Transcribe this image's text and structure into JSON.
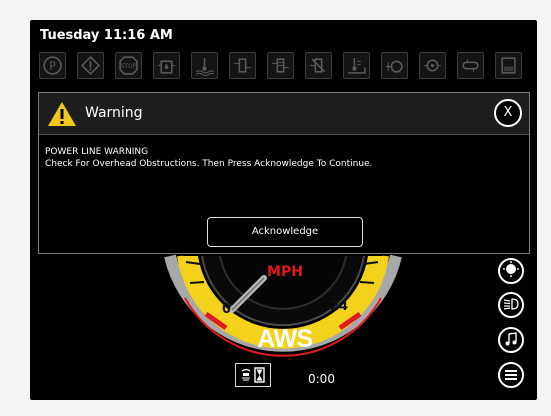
{
  "header": {
    "datetime": "Tuesday 11:16 AM"
  },
  "status_icons": [
    "parking-brake-icon",
    "warning-triangle-icon",
    "stop-icon",
    "fuel-water-icon",
    "coolant-temp-icon",
    "hydraulic-filter-icon",
    "hydraulic-filter-2-icon",
    "filter-restriction-icon",
    "hydraulic-temp-icon",
    "engine-icon",
    "alternator-icon",
    "transmission-icon",
    "fuel-level-icon"
  ],
  "warning": {
    "title": "Warning",
    "close_label": "X",
    "line1": "POWER LINE WARNING",
    "line2": "Check For Overhead Obstructions.  Then Press Acknowledge To Continue.",
    "acknowledge_label": "Acknowledge"
  },
  "gauge": {
    "unit": "MPH",
    "scale_min": "0",
    "scale_max": "24",
    "steer_mode": "AWS",
    "timer": "0:00",
    "colors": {
      "accent": "#f2d21b",
      "needle_marker": "#e0191e"
    }
  },
  "side_buttons": [
    "brightness-icon",
    "headlight-icon",
    "music-icon",
    "menu-icon"
  ]
}
